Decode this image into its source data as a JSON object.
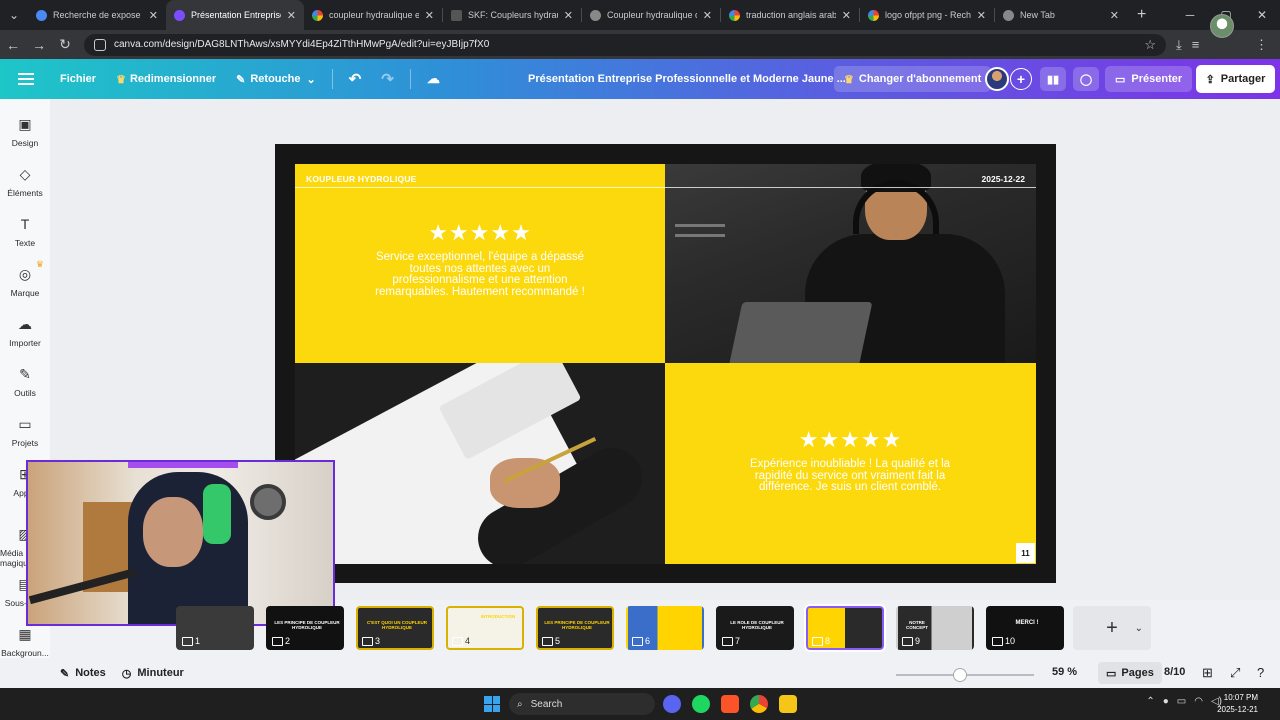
{
  "browser": {
    "tabs": [
      {
        "title": "Recherche de expose p",
        "favicon": "app-icon",
        "active": false
      },
      {
        "title": "Présentation Entreprise",
        "favicon": "canva-icon",
        "active": true
      },
      {
        "title": "coupleur hydraulique e",
        "favicon": "google-icon",
        "active": false
      },
      {
        "title": "SKF: Coupleurs hydrauli",
        "favicon": "skf-icon",
        "active": false
      },
      {
        "title": "Coupleur hydraulique d",
        "favicon": "chrome-icon",
        "active": false
      },
      {
        "title": "traduction anglais arab",
        "favicon": "google-icon",
        "active": false
      },
      {
        "title": "logo ofppt png - Reche",
        "favicon": "google-icon",
        "active": false
      },
      {
        "title": "New Tab",
        "favicon": "chrome-icon",
        "active": false
      }
    ],
    "url": "canva.com/design/DAG8LNThAws/xsMYYdi4Ep4ZiTthHMwPgA/edit?ui=eyJBIjp7fX0"
  },
  "toolbar": {
    "file": "Fichier",
    "resize": "Redimensionner",
    "edit": "Retouche",
    "doc_title": "Présentation Entreprise Professionnelle et Moderne Jaune ...",
    "upgrade": "Changer d'abonnement",
    "present": "Présenter",
    "share": "Partager"
  },
  "sidebar": {
    "items": [
      {
        "label": "Design",
        "icon": "layout-icon"
      },
      {
        "label": "Éléments",
        "icon": "shapes-icon"
      },
      {
        "label": "Texte",
        "icon": "text-icon"
      },
      {
        "label": "Marque",
        "icon": "brand-icon"
      },
      {
        "label": "Importer",
        "icon": "upload-icon"
      },
      {
        "label": "Outils",
        "icon": "pen-icon"
      },
      {
        "label": "Projets",
        "icon": "folder-icon"
      },
      {
        "label": "Applis",
        "icon": "apps-icon"
      },
      {
        "label": "Média magique",
        "icon": "magic-media-icon"
      },
      {
        "label": "Sous-titres",
        "icon": "subtitles-icon"
      },
      {
        "label": "Backgroun...",
        "icon": "background-icon"
      }
    ]
  },
  "slide": {
    "label": "KOUPLEUR HYDROLIQUE",
    "date": "2025-12-22",
    "rating_1": "★★★★★",
    "review_1": "Service exceptionnel, l'équipe a dépassé toutes nos attentes avec un professionnalisme et une attention remarquables. Hautement recommandé !",
    "rating_2": "★★★★★",
    "review_2": "Expérience inoubliable ! La qualité et la rapidité du service ont vraiment fait la différence. Je suis un client comblé.",
    "page_number": "11"
  },
  "thumbnails": [
    {
      "num": "1",
      "text": ""
    },
    {
      "num": "2",
      "text": "LES PRINCIPE DE COUPLEUR HYDROLIQUE"
    },
    {
      "num": "3",
      "text": "C'EST QUOI UN COUPLEUR HYDROLIQUE"
    },
    {
      "num": "4",
      "text": "INTRODUCTION"
    },
    {
      "num": "5",
      "text": "LES PRINCIPE DE COUPLEUR HYDROLIQUE"
    },
    {
      "num": "6",
      "text": ""
    },
    {
      "num": "7",
      "text": "LE ROLE DE COUPLEUR HYDROLIQUE"
    },
    {
      "num": "8",
      "text": ""
    },
    {
      "num": "9",
      "text": "NOTRE CONCEPT"
    },
    {
      "num": "10",
      "text": "MERCI !"
    }
  ],
  "status": {
    "notes": "Notes",
    "timer": "Minuteur",
    "zoom": "59 %",
    "zoom_fraction": 0.59,
    "pages": "Pages",
    "page_counter": "8/10"
  },
  "taskbar": {
    "search": "Search",
    "time": "10:07 PM",
    "date": "2025-12-21"
  },
  "colors": {
    "slide_yellow": "#fcd90d",
    "canva_gradient_start": "#1ec6c8",
    "canva_gradient_end": "#7d33e6",
    "active_thumb": "#8a5cf6"
  }
}
